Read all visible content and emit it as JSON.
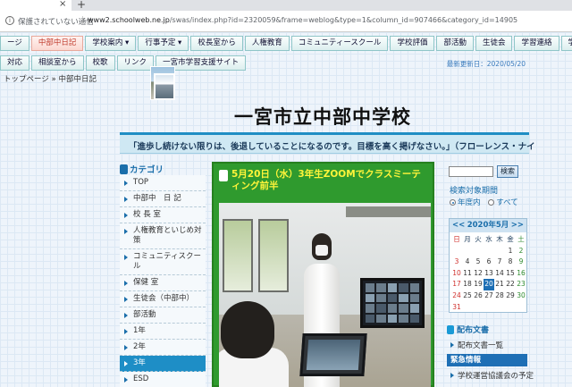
{
  "browser": {
    "tab_close": "×",
    "new_tab": "+",
    "security_text": "保護されていない通信",
    "url_domain": "www2.schoolweb.ne.jp",
    "url_path": "/swas/index.php?id=2320059&frame=weblog&type=1&column_id=907466&category_id=14905"
  },
  "nav_row1": [
    "ージ",
    "中部中日記",
    "学校案内 ▾",
    "行事予定 ▾",
    "校長室から",
    "人権教育",
    "コミュニティースクール",
    "学校評価",
    "部活動",
    "生徒会",
    "学習連絡",
    "学年通"
  ],
  "nav_row2": [
    "対応",
    "相談室から",
    "校歌",
    "リンク",
    "一宮市学習支援サイト"
  ],
  "nav_active_index": 1,
  "breadcrumb": {
    "home": "トップページ",
    "sep": "»",
    "current": "中部中日記"
  },
  "header": {
    "updated": "最新更新日：2020/05/20",
    "school_name": "一宮市立中部中学校",
    "motto": "「進歩し続けない限りは、後退していることになるのです。目標を高く掲げなさい。」（フローレンス・ナイ"
  },
  "categories": {
    "heading": "カテゴリ",
    "items": [
      "TOP",
      "中部中　日 記",
      "校 長 室",
      "人権教育といじめ対策",
      "コミュニティスクール",
      "保健 室",
      "生徒会（中部中）",
      "部活動",
      "1年",
      "2年",
      "3年",
      "ESD"
    ],
    "selected_index": 10
  },
  "post": {
    "title": "5月20日（水）3年生ZOOMでクラスミーティング前半"
  },
  "search": {
    "button": "検索",
    "scope_label": "検索対象期間",
    "options": [
      "年度内",
      "すべて"
    ],
    "selected": 0
  },
  "calendar": {
    "prev": "<<",
    "next": ">>",
    "title": "2020年5月",
    "dow": [
      "日",
      "月",
      "火",
      "水",
      "木",
      "金",
      "土"
    ],
    "weeks": [
      [
        "",
        "",
        "",
        "",
        "",
        "1",
        "2"
      ],
      [
        "3",
        "4",
        "5",
        "6",
        "7",
        "8",
        "9"
      ],
      [
        "10",
        "11",
        "12",
        "13",
        "14",
        "15",
        "16"
      ],
      [
        "17",
        "18",
        "19",
        "20",
        "21",
        "22",
        "23"
      ],
      [
        "24",
        "25",
        "26",
        "27",
        "28",
        "29",
        "30"
      ],
      [
        "31",
        "",
        "",
        "",
        "",
        "",
        ""
      ]
    ],
    "today": "20"
  },
  "docs": {
    "heading": "配布文書",
    "link": "配布文書一覧"
  },
  "emergency": {
    "heading": "緊急情報",
    "link": "学校運営協議会の予定"
  }
}
